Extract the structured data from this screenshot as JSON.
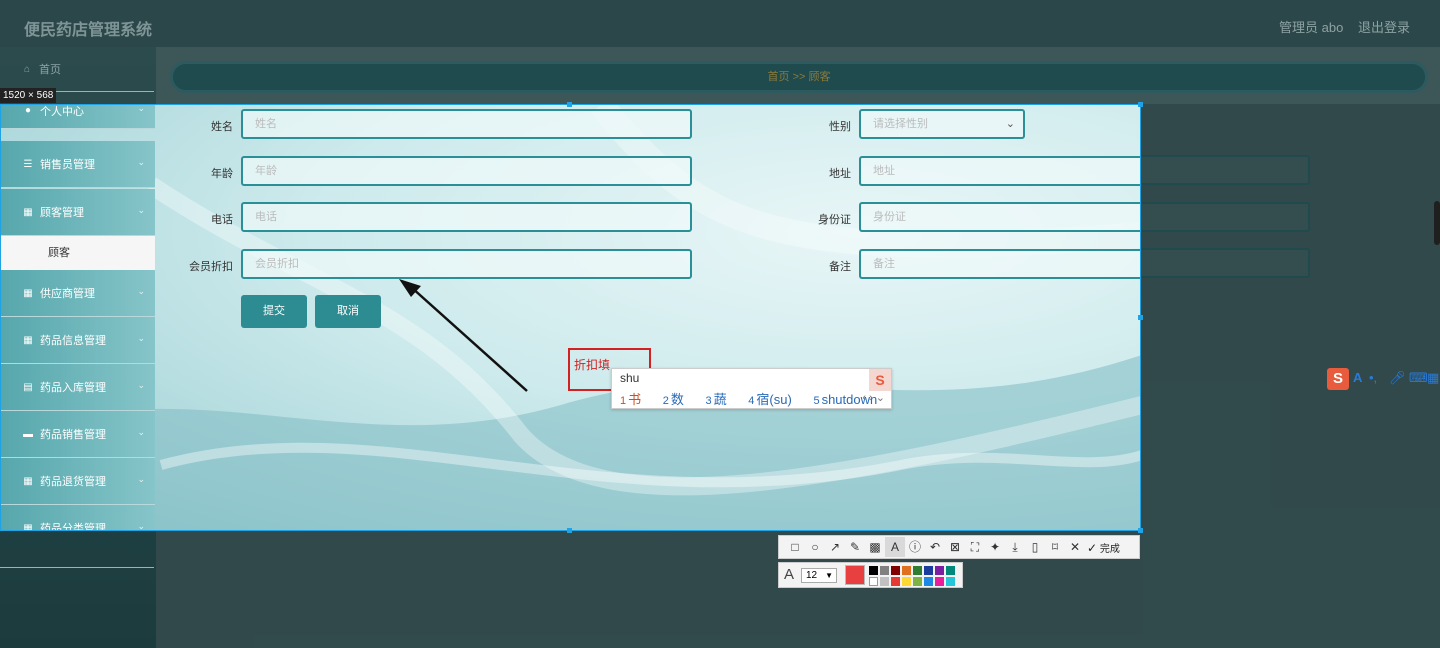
{
  "app": {
    "title": "便民药店管理系统",
    "user": "管理员 abo",
    "logout": "退出登录"
  },
  "breadcrumb": "首页  >>  顾客",
  "sidebar": {
    "home": "首页",
    "items": [
      {
        "label": "个人中心",
        "icon": "user-icon"
      },
      {
        "label": "销售员管理",
        "icon": "list-icon"
      },
      {
        "label": "顾客管理",
        "icon": "grid-icon"
      },
      {
        "label": "供应商管理",
        "icon": "grid-icon"
      },
      {
        "label": "药品信息管理",
        "icon": "grid-icon"
      },
      {
        "label": "药品入库管理",
        "icon": "clipboard-icon"
      },
      {
        "label": "药品销售管理",
        "icon": "briefcase-icon"
      },
      {
        "label": "药品退货管理",
        "icon": "grid-icon"
      },
      {
        "label": "药品分类管理",
        "icon": "grid-icon"
      }
    ],
    "sub_item": "顾客"
  },
  "form": {
    "name_label": "姓名",
    "name_placeholder": "姓名",
    "gender_label": "性别",
    "gender_placeholder": "请选择性别",
    "age_label": "年龄",
    "age_placeholder": "年龄",
    "address_label": "地址",
    "address_placeholder": "地址",
    "phone_label": "电话",
    "phone_placeholder": "电话",
    "id_label": "身份证",
    "id_placeholder": "身份证",
    "discount_label": "会员折扣",
    "discount_placeholder": "会员折扣",
    "remark_label": "备注",
    "remark_placeholder": "备注",
    "submit": "提交",
    "cancel": "取消"
  },
  "capture": {
    "dimensions": "1520 × 568",
    "annotation_text": "折扣填",
    "toolbar_done": "完成",
    "font_size": "12",
    "accent_color": "#1fa3e5",
    "draw_color": "#e84040"
  },
  "ime": {
    "input": "shu",
    "candidates": [
      {
        "n": "1",
        "text": "书"
      },
      {
        "n": "2",
        "text": "数"
      },
      {
        "n": "3",
        "text": "蔬"
      },
      {
        "n": "4",
        "text": "宿(su)"
      },
      {
        "n": "5",
        "text": "shutdown"
      }
    ],
    "logo": "S",
    "bar_text": "A"
  }
}
